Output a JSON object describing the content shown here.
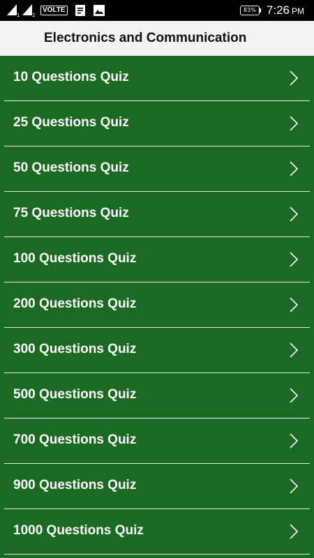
{
  "status_bar": {
    "sim1_slot": "1",
    "sim2_slot": "2",
    "network_label": "VOLTE",
    "battery_percent": "83%",
    "time": "7:26",
    "ampm": "PM"
  },
  "app_bar": {
    "title": "Electronics and Communication"
  },
  "quiz_list": {
    "items": [
      {
        "label": "10 Questions Quiz"
      },
      {
        "label": "25 Questions Quiz"
      },
      {
        "label": "50 Questions Quiz"
      },
      {
        "label": "75 Questions Quiz"
      },
      {
        "label": "100 Questions Quiz"
      },
      {
        "label": "200 Questions Quiz"
      },
      {
        "label": "300 Questions Quiz"
      },
      {
        "label": "500 Questions Quiz"
      },
      {
        "label": "700 Questions Quiz"
      },
      {
        "label": "900 Questions Quiz"
      },
      {
        "label": "1000 Questions Quiz"
      }
    ]
  },
  "colors": {
    "list_background": "#1b6a22",
    "app_bar_background": "#f3f3f3",
    "status_bar_background": "#000000"
  },
  "icons": [
    "signal-icon",
    "document-icon",
    "image-icon",
    "battery-icon",
    "chevron-right-icon"
  ]
}
